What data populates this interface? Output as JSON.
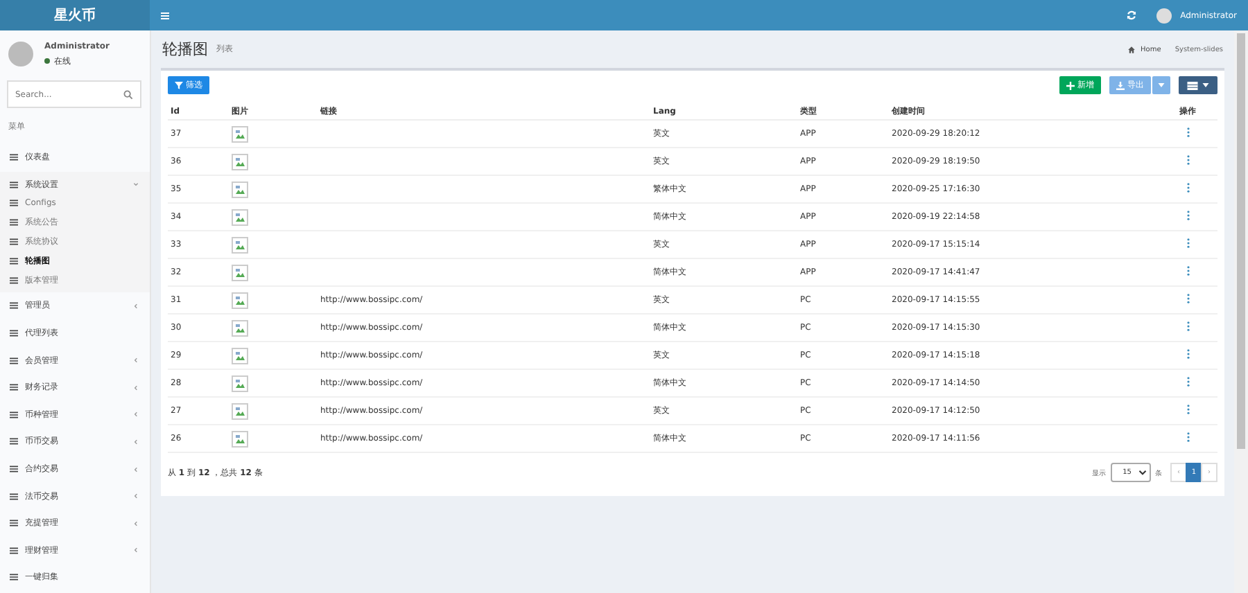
{
  "brand": "星火币",
  "topbar": {
    "user": "Administrator"
  },
  "sidebar": {
    "user": {
      "name": "Administrator",
      "status": "在线"
    },
    "search": {
      "placeholder": "Search..."
    },
    "header": "菜单",
    "items": [
      {
        "label": "仪表盘",
        "selected": false
      },
      {
        "label": "系统设置",
        "selected": false,
        "expanded": true,
        "children": [
          {
            "label": "Configs",
            "selected": false
          },
          {
            "label": "系统公告",
            "selected": false
          },
          {
            "label": "系统协议",
            "selected": false
          },
          {
            "label": "轮播图",
            "selected": true
          },
          {
            "label": "版本管理",
            "selected": false
          }
        ]
      },
      {
        "label": "管理员",
        "selected": false,
        "expanded": false
      },
      {
        "label": "代理列表",
        "selected": false
      },
      {
        "label": "会员管理",
        "selected": false,
        "expanded": false
      },
      {
        "label": "财务记录",
        "selected": false,
        "expanded": false
      },
      {
        "label": "币种管理",
        "selected": false,
        "expanded": false
      },
      {
        "label": "币币交易",
        "selected": false,
        "expanded": false
      },
      {
        "label": "合约交易",
        "selected": false,
        "expanded": false
      },
      {
        "label": "法币交易",
        "selected": false,
        "expanded": false
      },
      {
        "label": "充提管理",
        "selected": false,
        "expanded": false
      },
      {
        "label": "理财管理",
        "selected": false,
        "expanded": false
      },
      {
        "label": "一键归集",
        "selected": false
      }
    ]
  },
  "page": {
    "title": "轮播图",
    "subtitle": "列表",
    "breadcrumb": [
      "Home",
      "System-slides"
    ]
  },
  "toolbar": {
    "filter": "筛选",
    "add": "新增",
    "export": "导出"
  },
  "table": {
    "columns": [
      "Id",
      "图片",
      "链接",
      "Lang",
      "类型",
      "创建时间",
      "操作"
    ],
    "rows": [
      {
        "id": "37",
        "link": "",
        "lang": "英文",
        "type": "APP",
        "created": "2020-09-29 18:20:12"
      },
      {
        "id": "36",
        "link": "",
        "lang": "英文",
        "type": "APP",
        "created": "2020-09-29 18:19:50"
      },
      {
        "id": "35",
        "link": "",
        "lang": "繁体中文",
        "type": "APP",
        "created": "2020-09-25 17:16:30"
      },
      {
        "id": "34",
        "link": "",
        "lang": "简体中文",
        "type": "APP",
        "created": "2020-09-19 22:14:58"
      },
      {
        "id": "33",
        "link": "",
        "lang": "英文",
        "type": "APP",
        "created": "2020-09-17 15:15:14"
      },
      {
        "id": "32",
        "link": "",
        "lang": "简体中文",
        "type": "APP",
        "created": "2020-09-17 14:41:47"
      },
      {
        "id": "31",
        "link": "http://www.bossipc.com/",
        "lang": "英文",
        "type": "PC",
        "created": "2020-09-17 14:15:55"
      },
      {
        "id": "30",
        "link": "http://www.bossipc.com/",
        "lang": "简体中文",
        "type": "PC",
        "created": "2020-09-17 14:15:30"
      },
      {
        "id": "29",
        "link": "http://www.bossipc.com/",
        "lang": "英文",
        "type": "PC",
        "created": "2020-09-17 14:15:18"
      },
      {
        "id": "28",
        "link": "http://www.bossipc.com/",
        "lang": "简体中文",
        "type": "PC",
        "created": "2020-09-17 14:14:50"
      },
      {
        "id": "27",
        "link": "http://www.bossipc.com/",
        "lang": "英文",
        "type": "PC",
        "created": "2020-09-17 14:12:50"
      },
      {
        "id": "26",
        "link": "http://www.bossipc.com/",
        "lang": "简体中文",
        "type": "PC",
        "created": "2020-09-17 14:11:56"
      }
    ]
  },
  "footer": {
    "summary": "从 **1** 到 **12** ，总共 **12** 条",
    "show": "显示",
    "per_page": "15",
    "unit": "条",
    "pages": [
      {
        "label": "‹",
        "selected": false
      },
      {
        "label": "1",
        "selected": true
      },
      {
        "label": "›",
        "selected": false
      }
    ]
  }
}
